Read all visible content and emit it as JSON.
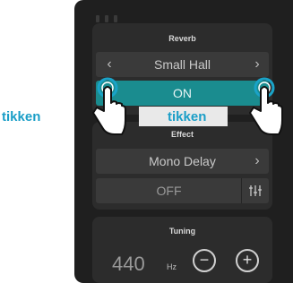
{
  "reverb": {
    "title": "Reverb",
    "type_value": "Small Hall",
    "prev_symbol": "‹",
    "next_symbol": "›",
    "toggle_state": "ON"
  },
  "effect": {
    "title": "Effect",
    "type_value": "Mono Delay",
    "next_symbol": "›",
    "toggle_state": "OFF",
    "settings_icon": "equalizer-sliders-icon"
  },
  "tuning": {
    "title": "Tuning",
    "value": "440",
    "unit": "Hz",
    "minus_symbol": "−",
    "plus_symbol": "+"
  },
  "annotations": {
    "left_tap_label": "tikken",
    "right_tap_label": "tikken"
  },
  "colors": {
    "accent": "#1a8c8f",
    "tap_label": "#1a9ec7",
    "ring": "#1aa3c8"
  }
}
